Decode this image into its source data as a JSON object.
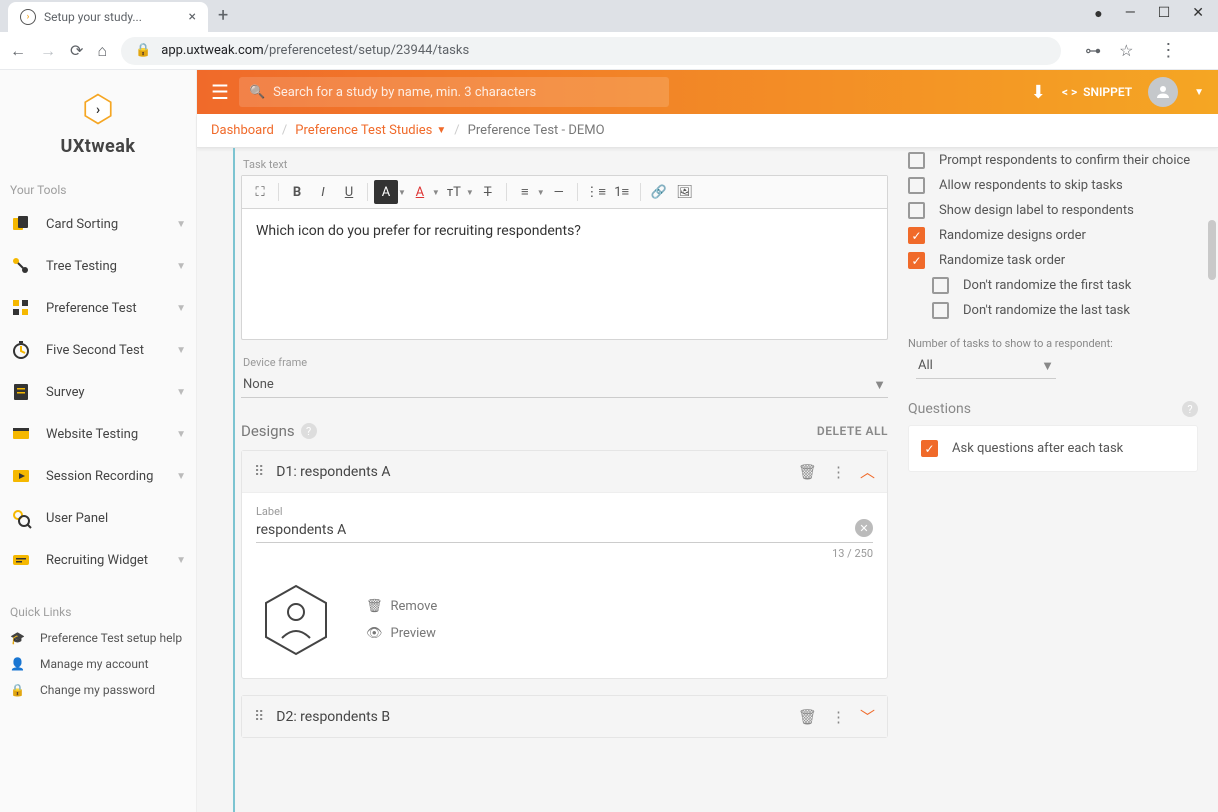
{
  "browser": {
    "tab_title": "Setup your study...",
    "url_domain": "app.uxtweak.com",
    "url_path": "/preferencetest/setup/23944/tasks"
  },
  "logo": {
    "text": "UXtweak"
  },
  "sidebar": {
    "tools_header": "Your Tools",
    "tools": [
      {
        "label": "Card Sorting"
      },
      {
        "label": "Tree Testing"
      },
      {
        "label": "Preference Test"
      },
      {
        "label": "Five Second Test"
      },
      {
        "label": "Survey"
      },
      {
        "label": "Website Testing"
      },
      {
        "label": "Session Recording"
      },
      {
        "label": "User Panel"
      },
      {
        "label": "Recruiting Widget"
      }
    ],
    "quicklinks_header": "Quick Links",
    "quicklinks": [
      {
        "label": "Preference Test setup help"
      },
      {
        "label": "Manage my account"
      },
      {
        "label": "Change my password"
      }
    ]
  },
  "topbar": {
    "search_placeholder": "Search for a study by name, min. 3 characters",
    "snippet_label": "SNIPPET"
  },
  "breadcrumb": {
    "dashboard": "Dashboard",
    "studies": "Preference Test Studies",
    "current": "Preference Test - DEMO"
  },
  "task": {
    "task_text_label": "Task text",
    "task_text_value": "Which icon do you prefer for recruiting respondents?",
    "device_frame_label": "Device frame",
    "device_frame_value": "None"
  },
  "designs": {
    "section_title": "Designs",
    "delete_all": "DELETE ALL",
    "d1": {
      "header": "D1: respondents A",
      "label_label": "Label",
      "label_value": "respondents A",
      "counter": "13 / 250",
      "remove": "Remove",
      "preview": "Preview"
    },
    "d2": {
      "header": "D2: respondents B"
    }
  },
  "options": {
    "prompt_confirm": "Prompt respondents to confirm their choice",
    "allow_skip": "Allow respondents to skip tasks",
    "show_label": "Show design label to respondents",
    "rand_designs": "Randomize designs order",
    "rand_tasks": "Randomize task order",
    "no_rand_first": "Don't randomize the first task",
    "no_rand_last": "Don't randomize the last task",
    "num_tasks_label": "Number of tasks to show to a respondent:",
    "num_tasks_value": "All"
  },
  "questions": {
    "header": "Questions",
    "ask_after": "Ask questions after each task"
  }
}
